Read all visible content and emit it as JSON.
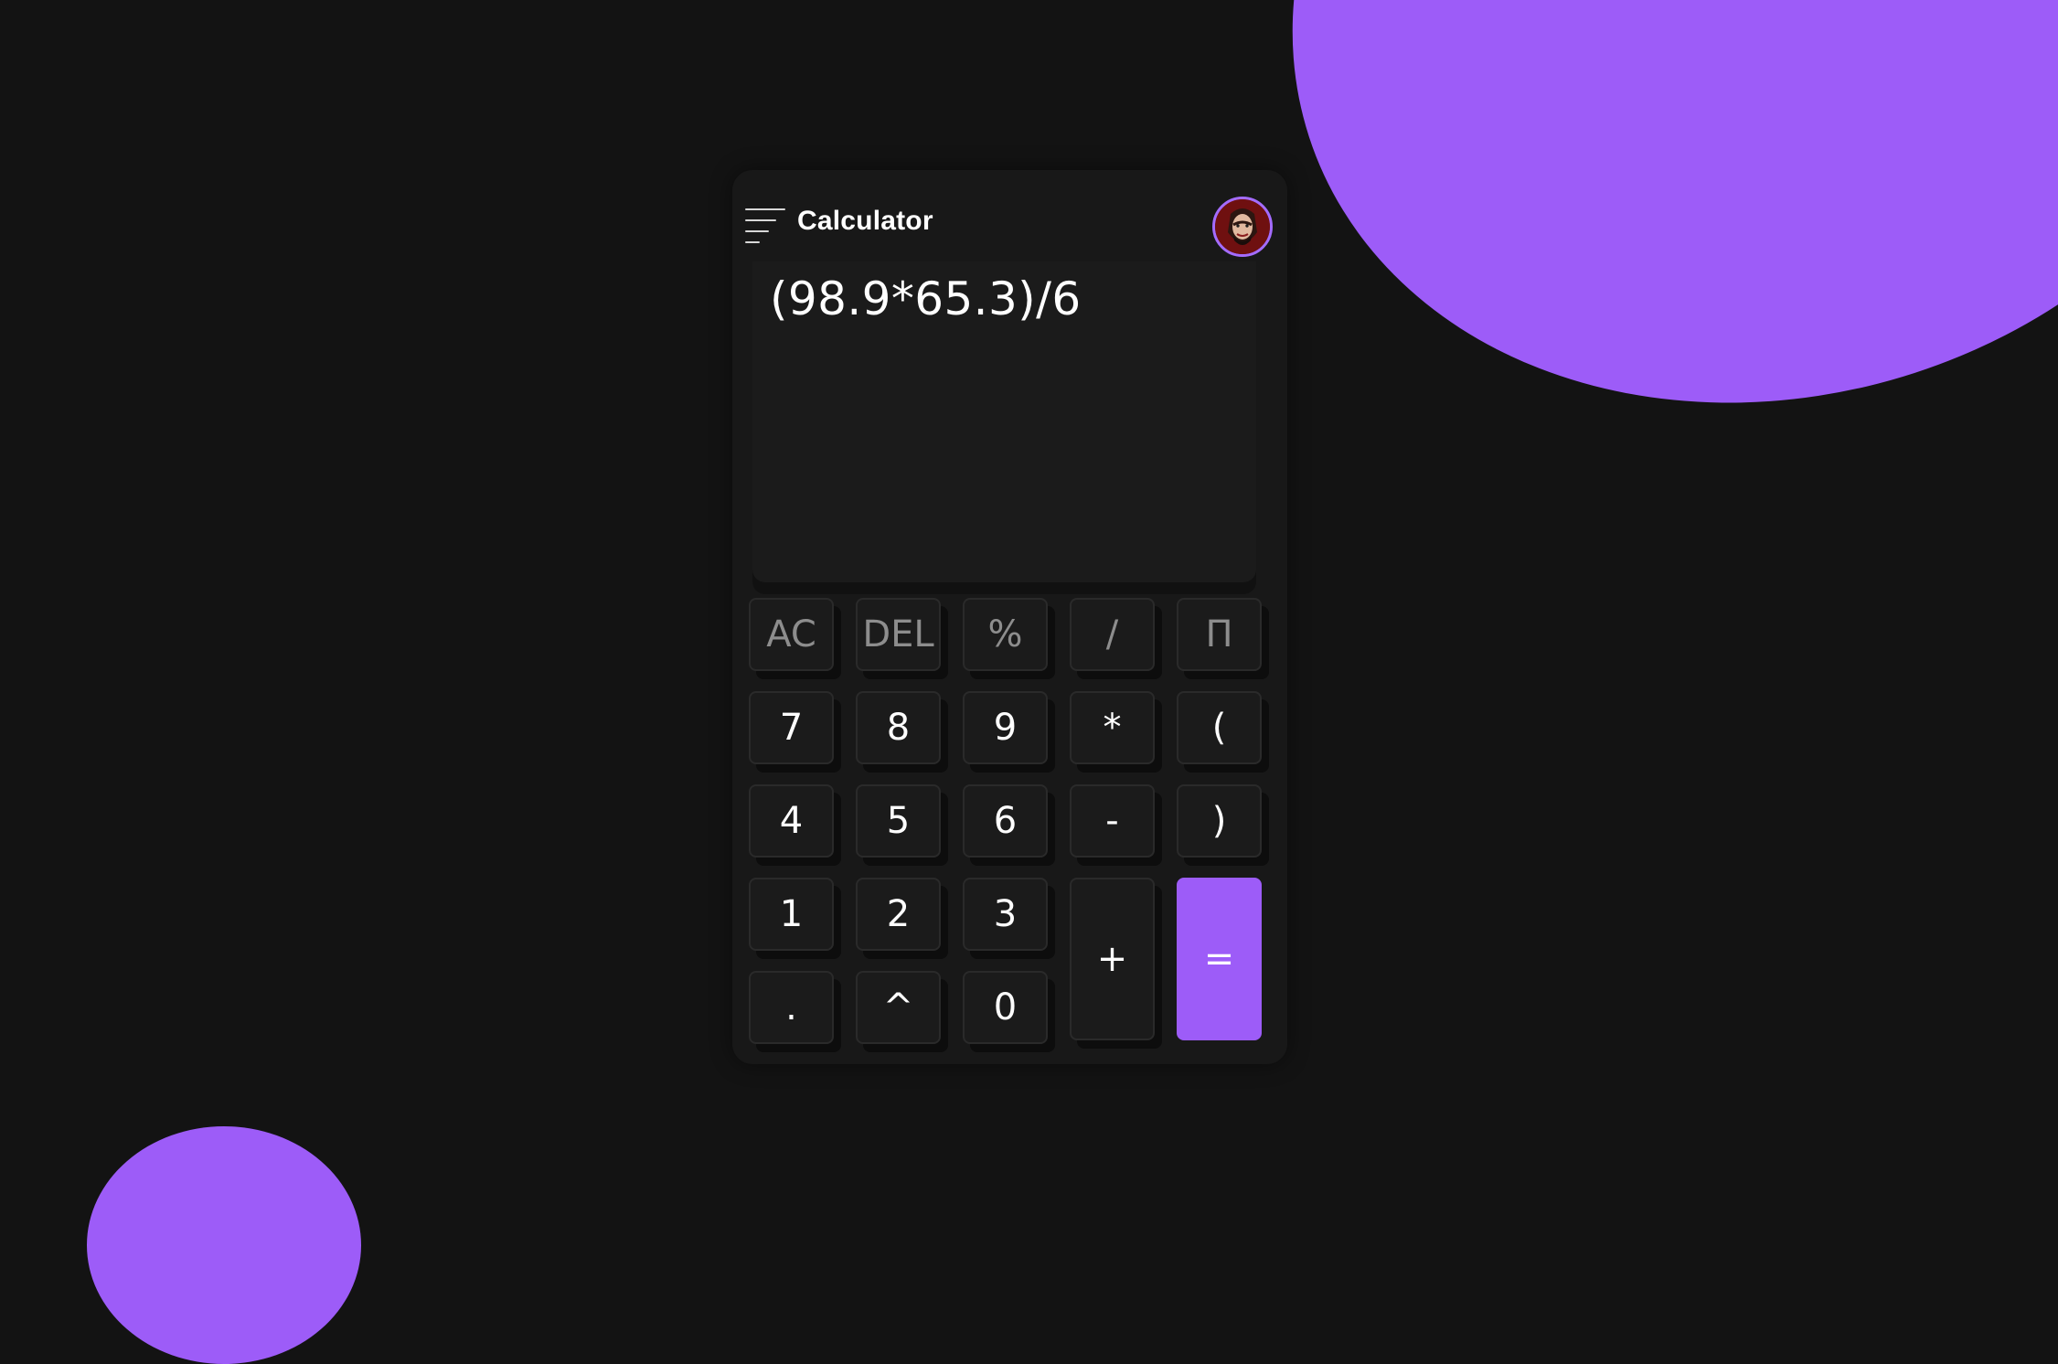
{
  "app": {
    "title": "Calculator",
    "avatar": "avatar",
    "accent_color": "#9d5cf8",
    "background_color": "#131313"
  },
  "display": {
    "expression": "(98.9*65.3)/6"
  },
  "keys": {
    "ac": "AC",
    "del": "DEL",
    "percent": "%",
    "divide": "/",
    "pi": "Π",
    "seven": "7",
    "eight": "8",
    "nine": "9",
    "multiply": "*",
    "open_paren": "(",
    "four": "4",
    "five": "5",
    "six": "6",
    "minus": "-",
    "close_paren": ")",
    "one": "1",
    "two": "2",
    "three": "3",
    "plus": "+",
    "equals": "=",
    "decimal": ".",
    "power": "^",
    "zero": "0"
  },
  "icons": {
    "menu": "menu-icon",
    "avatar": "avatar-icon"
  }
}
